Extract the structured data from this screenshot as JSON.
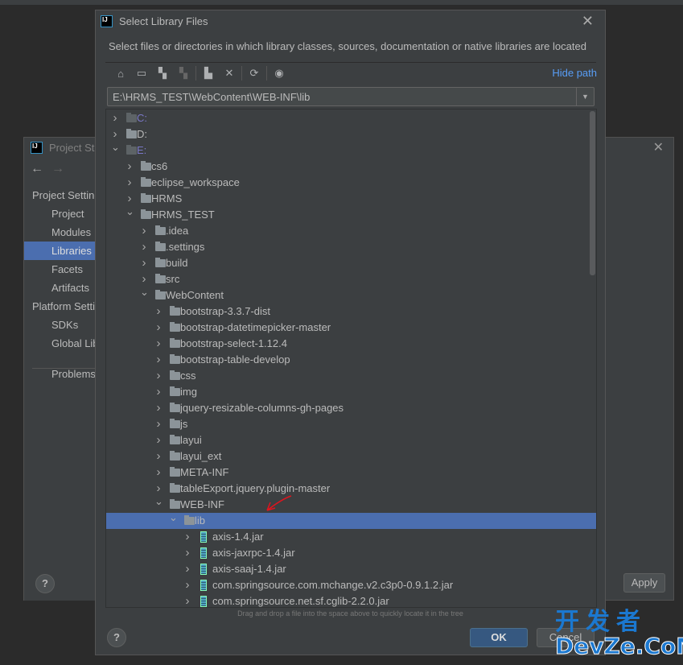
{
  "back_window": {
    "title": "Project Structure",
    "sidebar": [
      {
        "label": "Project Settings",
        "header": true
      },
      {
        "label": "Project"
      },
      {
        "label": "Modules"
      },
      {
        "label": "Libraries",
        "selected": true
      },
      {
        "label": "Facets"
      },
      {
        "label": "Artifacts"
      },
      {
        "label": "Platform Settings",
        "header": true
      },
      {
        "label": "SDKs"
      },
      {
        "label": "Global Libraries"
      },
      {
        "label": "Problems"
      }
    ],
    "apply_label": "Apply",
    "help_label": "?"
  },
  "dialog": {
    "title": "Select Library Files",
    "description": "Select files or directories in which library classes, sources, documentation or native libraries are located",
    "toolbar": {
      "icons": [
        "home-icon",
        "desktop-icon",
        "project-folder-icon",
        "module-folder-icon",
        "new-folder-icon",
        "delete-icon",
        "refresh-icon",
        "show-hidden-icon"
      ],
      "hide_path": "Hide path"
    },
    "path": "E:\\HRMS_TEST\\WebContent\\WEB-INF\\lib",
    "tree": [
      {
        "l": 0,
        "n": "C:",
        "t": "drive",
        "e": false
      },
      {
        "l": 0,
        "n": "D:",
        "t": "drive2",
        "e": false
      },
      {
        "l": 0,
        "n": "E:",
        "t": "drive",
        "e": true
      },
      {
        "l": 1,
        "n": "cs6"
      },
      {
        "l": 1,
        "n": "eclipse_workspace"
      },
      {
        "l": 1,
        "n": "HRMS"
      },
      {
        "l": 1,
        "n": "HRMS_TEST",
        "e": true
      },
      {
        "l": 2,
        "n": ".idea"
      },
      {
        "l": 2,
        "n": ".settings"
      },
      {
        "l": 2,
        "n": "build"
      },
      {
        "l": 2,
        "n": "src"
      },
      {
        "l": 2,
        "n": "WebContent",
        "e": true
      },
      {
        "l": 3,
        "n": "bootstrap-3.3.7-dist"
      },
      {
        "l": 3,
        "n": "bootstrap-datetimepicker-master"
      },
      {
        "l": 3,
        "n": "bootstrap-select-1.12.4"
      },
      {
        "l": 3,
        "n": "bootstrap-table-develop"
      },
      {
        "l": 3,
        "n": "css"
      },
      {
        "l": 3,
        "n": "img"
      },
      {
        "l": 3,
        "n": "jquery-resizable-columns-gh-pages"
      },
      {
        "l": 3,
        "n": "js"
      },
      {
        "l": 3,
        "n": "layui"
      },
      {
        "l": 3,
        "n": "layui_ext"
      },
      {
        "l": 3,
        "n": "META-INF"
      },
      {
        "l": 3,
        "n": "tableExport.jquery.plugin-master"
      },
      {
        "l": 3,
        "n": "WEB-INF",
        "e": true
      },
      {
        "l": 4,
        "n": "lib",
        "e": true,
        "s": true
      },
      {
        "l": 5,
        "n": "axis-1.4.jar",
        "t": "jar"
      },
      {
        "l": 5,
        "n": "axis-jaxrpc-1.4.jar",
        "t": "jar"
      },
      {
        "l": 5,
        "n": "axis-saaj-1.4.jar",
        "t": "jar"
      },
      {
        "l": 5,
        "n": "com.springsource.com.mchange.v2.c3p0-0.9.1.2.jar",
        "t": "jar"
      },
      {
        "l": 5,
        "n": "com.springsource.net.sf.cglib-2.2.0.jar",
        "t": "jar"
      }
    ],
    "hint": "Drag and drop a file into the space above to quickly locate it in the tree",
    "ok_label": "OK",
    "cancel_label": "Cancel",
    "help_label": "?"
  },
  "watermark": {
    "line1": "开发者",
    "line2": "DevZe.CoM"
  },
  "colors": {
    "selection": "#4b6eaf",
    "link": "#589df6",
    "annotation_arrow": "#e0141e"
  }
}
